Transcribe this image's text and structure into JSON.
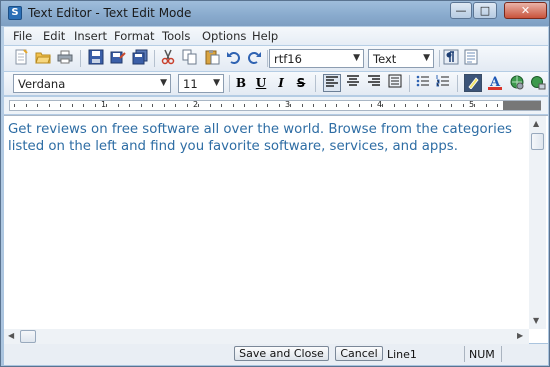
{
  "window": {
    "title": "Text Editor -  Text Edit Mode",
    "app_icon": "S"
  },
  "wm": {
    "minimize": "—",
    "maximize": "□",
    "close": "✕"
  },
  "menu": [
    "File",
    "Edit",
    "Insert",
    "Format",
    "Tools",
    "Options",
    "Help"
  ],
  "toolbar": {
    "format_value": "rtf16",
    "mode_value": "Text",
    "font_value": "Verdana",
    "size_value": "11",
    "bold": "B",
    "underline": "U",
    "italic": "I",
    "strike": "S"
  },
  "ruler": {
    "numbers": [
      "1",
      "2",
      "3",
      "4",
      "5"
    ]
  },
  "editor": {
    "text": "Get reviews on free software all over the world. Browse from the categories listed on the left and find you favorite software, services, and apps."
  },
  "status": {
    "save_close": "Save and Close",
    "cancel": "Cancel",
    "line": "Line1",
    "num": "NUM"
  },
  "colors": {
    "accent": "#2e6da4",
    "titlebar": "#88aacd"
  }
}
